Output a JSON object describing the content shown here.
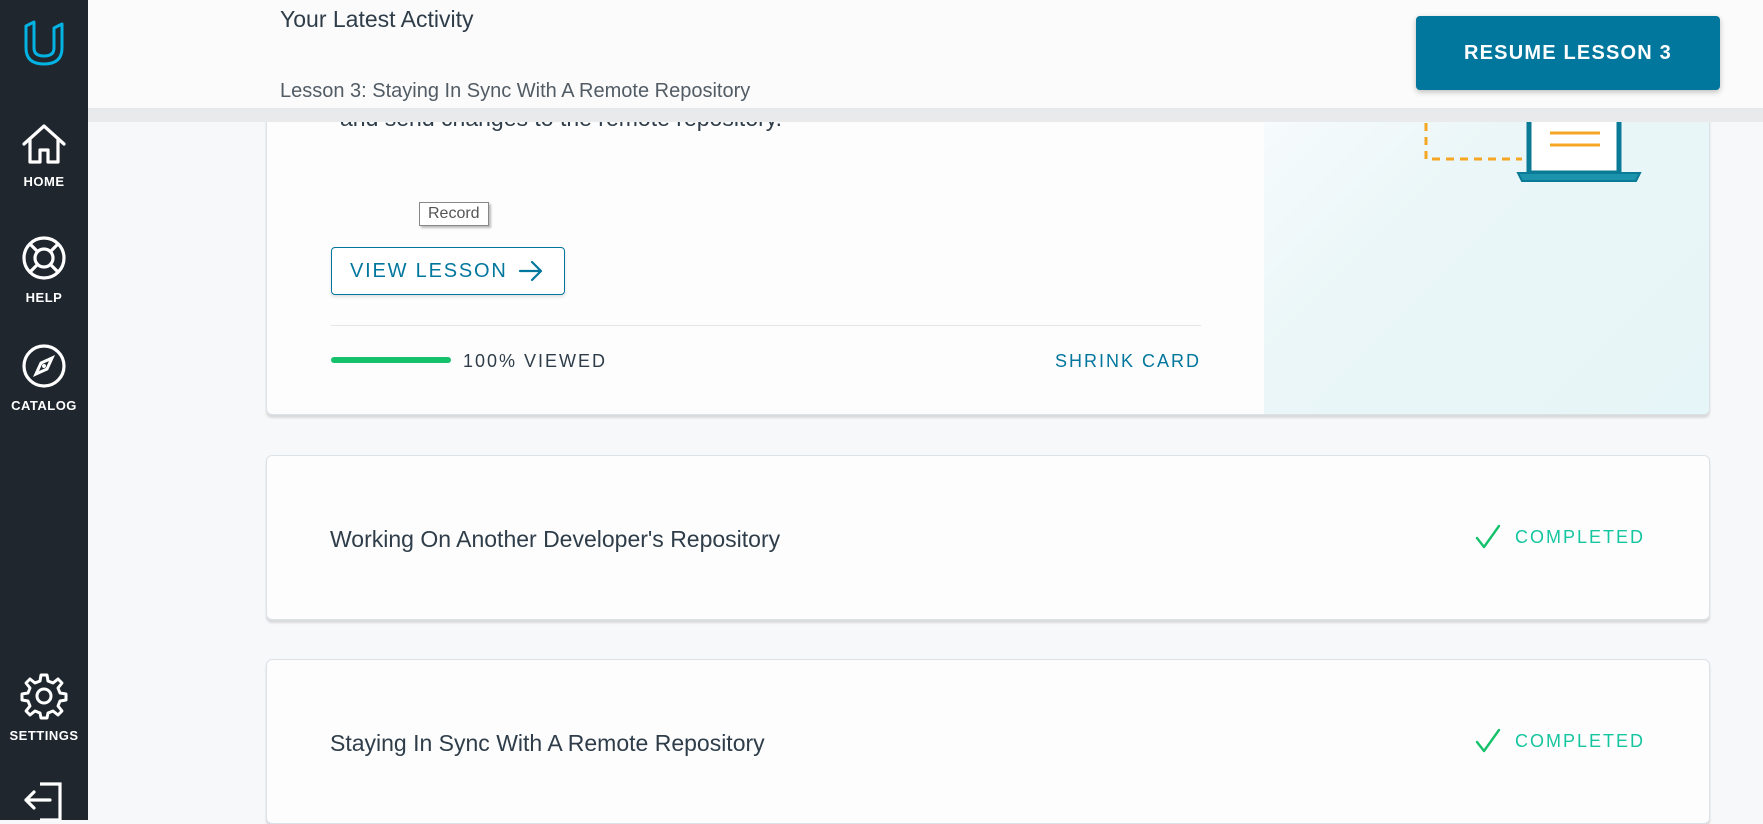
{
  "sidebar": {
    "items": [
      {
        "label": "HOME",
        "icon": "home-icon"
      },
      {
        "label": "HELP",
        "icon": "lifebuoy-icon"
      },
      {
        "label": "CATALOG",
        "icon": "compass-icon"
      },
      {
        "label": "SETTINGS",
        "icon": "gear-icon"
      }
    ],
    "logout_icon": "logout-icon"
  },
  "header": {
    "title": "Your Latest Activity",
    "subtitle": "Lesson 3: Staying In Sync With A Remote Repository",
    "resume_label": "RESUME LESSON 3"
  },
  "expanded_card": {
    "description": "and send changes to the remote repository.",
    "tooltip": "Record",
    "view_label": "VIEW LESSON",
    "progress_percent": 100,
    "viewed_label": "100% VIEWED",
    "shrink_label": "SHRINK CARD"
  },
  "lessons": [
    {
      "title": "Working On Another Developer's Repository",
      "status": "COMPLETED"
    },
    {
      "title": "Staying In Sync With A Remote Repository",
      "status": "COMPLETED"
    }
  ],
  "colors": {
    "sidebar": "#1f262e",
    "accent": "#02779e",
    "logo": "#02b3e4",
    "progress": "#15c26b",
    "completed": "#15c5a0",
    "illustration_yellow": "#f5a623"
  }
}
